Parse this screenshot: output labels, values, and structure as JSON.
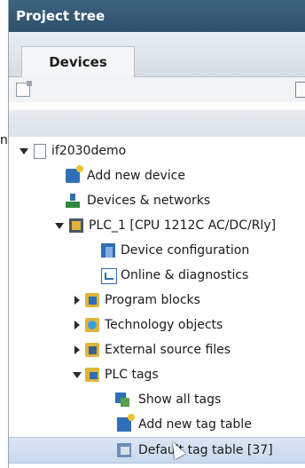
{
  "left_fragment": "n",
  "panel": {
    "title": "Project tree",
    "tab": "Devices"
  },
  "toolbar": {
    "left_icon": "project-view-icon",
    "right_icon": "view-options-icon"
  },
  "tree": {
    "items": [
      {
        "label": "if2030demo",
        "icon": "project-doc-icon",
        "expander": "down"
      },
      {
        "label": "Add new device",
        "icon": "add-device-icon",
        "expander": ""
      },
      {
        "label": "Devices & networks",
        "icon": "network-icon",
        "expander": ""
      },
      {
        "label": "PLC_1 [CPU 1212C AC/DC/Rly]",
        "icon": "plc-icon",
        "expander": "down"
      },
      {
        "label": "Device configuration",
        "icon": "device-config-icon",
        "expander": ""
      },
      {
        "label": "Online & diagnostics",
        "icon": "diagnostics-icon",
        "expander": ""
      },
      {
        "label": "Program blocks",
        "icon": "program-blocks-icon",
        "expander": "right"
      },
      {
        "label": "Technology objects",
        "icon": "technology-icon",
        "expander": "right"
      },
      {
        "label": "External source files",
        "icon": "external-files-icon",
        "expander": "right"
      },
      {
        "label": "PLC tags",
        "icon": "plc-tags-icon",
        "expander": "down"
      },
      {
        "label": "Show all tags",
        "icon": "show-tags-icon",
        "expander": ""
      },
      {
        "label": "Add new tag table",
        "icon": "add-table-icon",
        "expander": ""
      },
      {
        "label": "Default tag table [37]",
        "icon": "default-table-icon",
        "expander": "",
        "selected": true
      }
    ]
  },
  "colors": {
    "title_bar": "#2d4f69",
    "selection": "#c9d8ec",
    "accent": "#2f6fb5"
  }
}
